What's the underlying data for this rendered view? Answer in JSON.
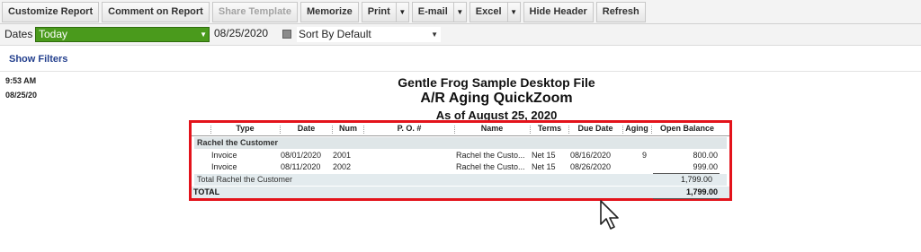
{
  "toolbar": {
    "customize": "Customize Report",
    "comment": "Comment on Report",
    "share": "Share Template",
    "memorize": "Memorize",
    "print": "Print",
    "email": "E-mail",
    "excel": "Excel",
    "hide_header": "Hide Header",
    "refresh": "Refresh"
  },
  "filters": {
    "dates_label": "Dates",
    "dates_value": "Today",
    "date": "08/25/2020",
    "sort": "Sort By Default"
  },
  "show_filters": "Show Filters",
  "report": {
    "time": "9:53 AM",
    "date": "08/25/20",
    "company": "Gentle Frog Sample Desktop File",
    "title": "A/R Aging QuickZoom",
    "as_of": "As of August 25, 2020",
    "columns": [
      "Type",
      "Date",
      "Num",
      "P. O. #",
      "Name",
      "Terms",
      "Due Date",
      "Aging",
      "Open Balance"
    ],
    "group": "Rachel the Customer",
    "rows": [
      {
        "type": "Invoice",
        "date": "08/01/2020",
        "num": "2001",
        "po": "",
        "name": "Rachel the Custo...",
        "terms": "Net 15",
        "due": "08/16/2020",
        "aging": "9",
        "balance": "800.00"
      },
      {
        "type": "Invoice",
        "date": "08/11/2020",
        "num": "2002",
        "po": "",
        "name": "Rachel the Custo...",
        "terms": "Net 15",
        "due": "08/26/2020",
        "aging": "",
        "balance": "999.00"
      }
    ],
    "group_total_label": "Total Rachel the Customer",
    "group_total": "1,799.00",
    "total_label": "TOTAL",
    "total": "1,799.00"
  },
  "colors": {
    "dates_bg": "#4a9a1c",
    "highlight_border": "#e3131b",
    "group_bg": "#dfe6e8"
  }
}
